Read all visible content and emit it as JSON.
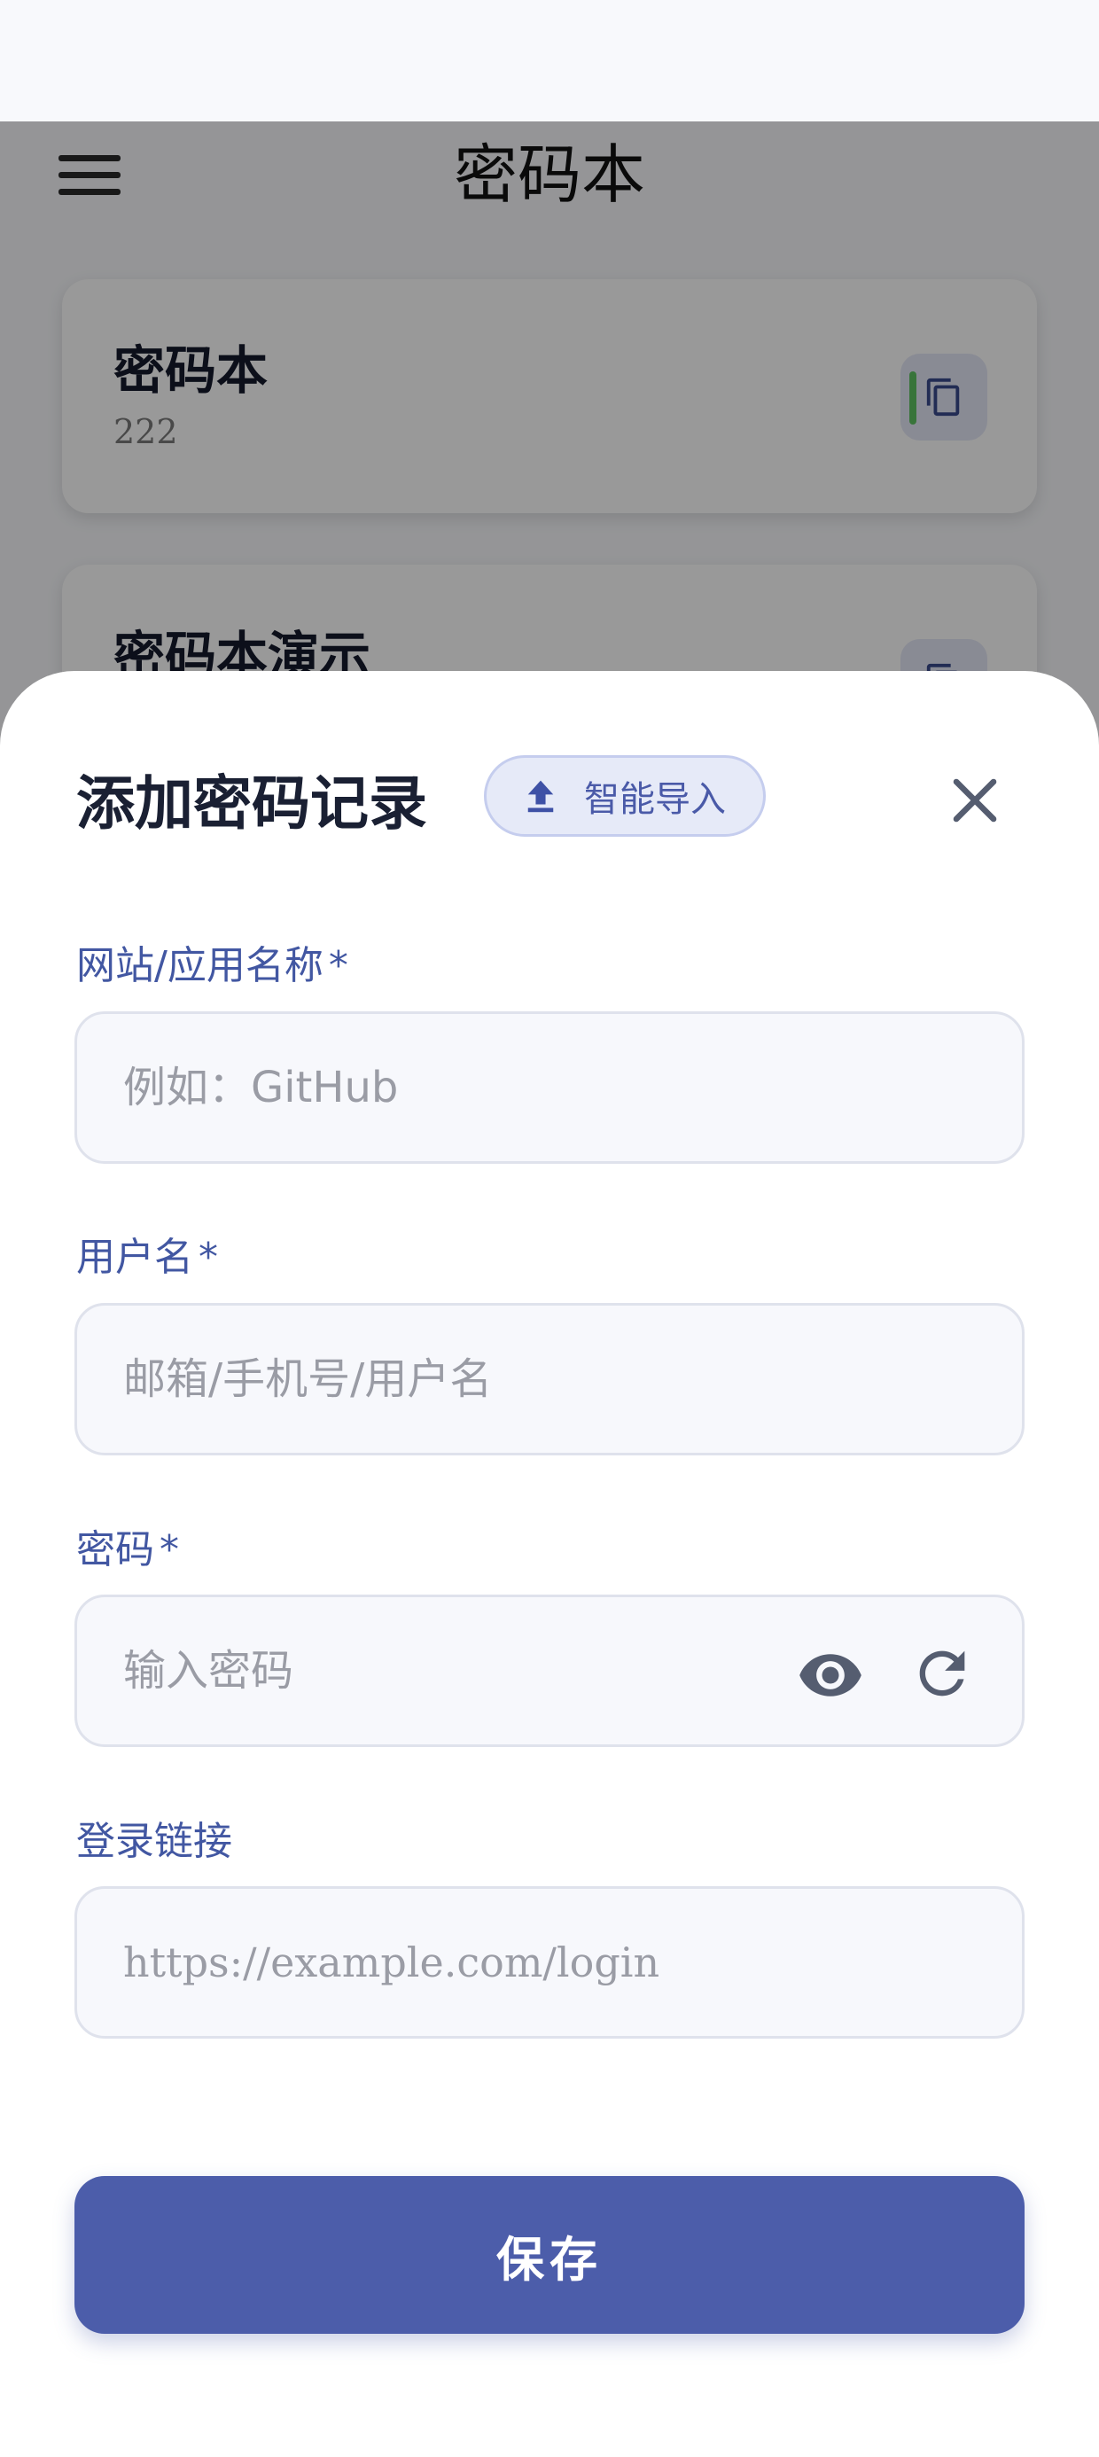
{
  "app": {
    "title": "密码本",
    "menu_icon": "hamburger-menu-icon"
  },
  "entries": [
    {
      "title": "密码本",
      "subtitle": "222",
      "action_icon": "copy-icon"
    },
    {
      "title": "密码本演示",
      "subtitle": "",
      "action_icon": "copy-icon"
    }
  ],
  "sheet": {
    "title": "添加密码记录",
    "import_label": "智能导入",
    "import_icon": "upload-icon",
    "close_icon": "close-icon",
    "fields": {
      "site": {
        "label": "网站/应用名称",
        "required_mark": "*",
        "placeholder": "例如：GitHub",
        "value": ""
      },
      "username": {
        "label": "用户名",
        "required_mark": "*",
        "placeholder": "邮箱/手机号/用户名",
        "value": ""
      },
      "password": {
        "label": "密码",
        "required_mark": "*",
        "placeholder": "输入密码",
        "value": "",
        "show_icon": "eye-icon",
        "generate_icon": "refresh-icon"
      },
      "url": {
        "label": "登录链接",
        "placeholder": "https://example.com/login",
        "value": ""
      }
    },
    "save_label": "保存"
  },
  "colors": {
    "accent": "#4c5daa",
    "label": "#4257a2",
    "overlay": "rgba(0,0,0,0.40)"
  }
}
